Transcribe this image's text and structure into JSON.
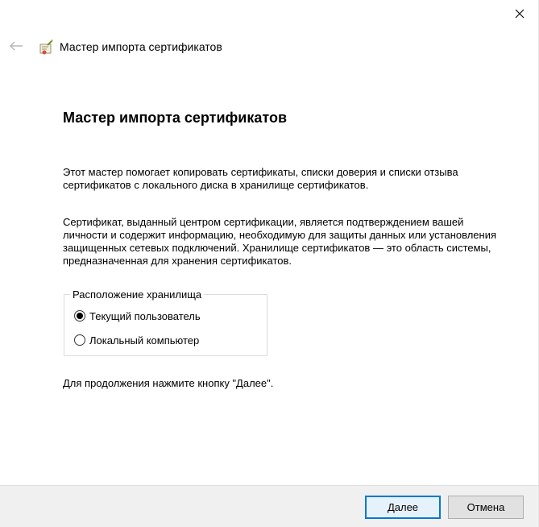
{
  "window": {
    "nav_title": "Мастер импорта сертификатов"
  },
  "content": {
    "heading": "Мастер импорта сертификатов",
    "paragraph1": "Этот мастер помогает копировать сертификаты, списки доверия и списки отзыва сертификатов с локального диска в хранилище сертификатов.",
    "paragraph2": "Сертификат, выданный центром сертификации, является подтверждением вашей личности и содержит информацию, необходимую для защиты данных или установления защищенных сетевых подключений. Хранилище сертификатов — это область системы, предназначенная для хранения сертификатов.",
    "store_location": {
      "legend": "Расположение хранилища",
      "options": [
        {
          "label": "Текущий пользователь",
          "selected": true
        },
        {
          "label": "Локальный компьютер",
          "selected": false
        }
      ]
    },
    "paragraph3": "Для продолжения нажмите кнопку \"Далее\"."
  },
  "footer": {
    "next_label": "Далее",
    "cancel_label": "Отмена"
  },
  "icons": {
    "close": "close-icon",
    "back": "back-arrow-icon",
    "wizard": "certificate-wizard-icon"
  },
  "colors": {
    "accent": "#0078d7",
    "footer_bg": "#f0f0f0"
  }
}
